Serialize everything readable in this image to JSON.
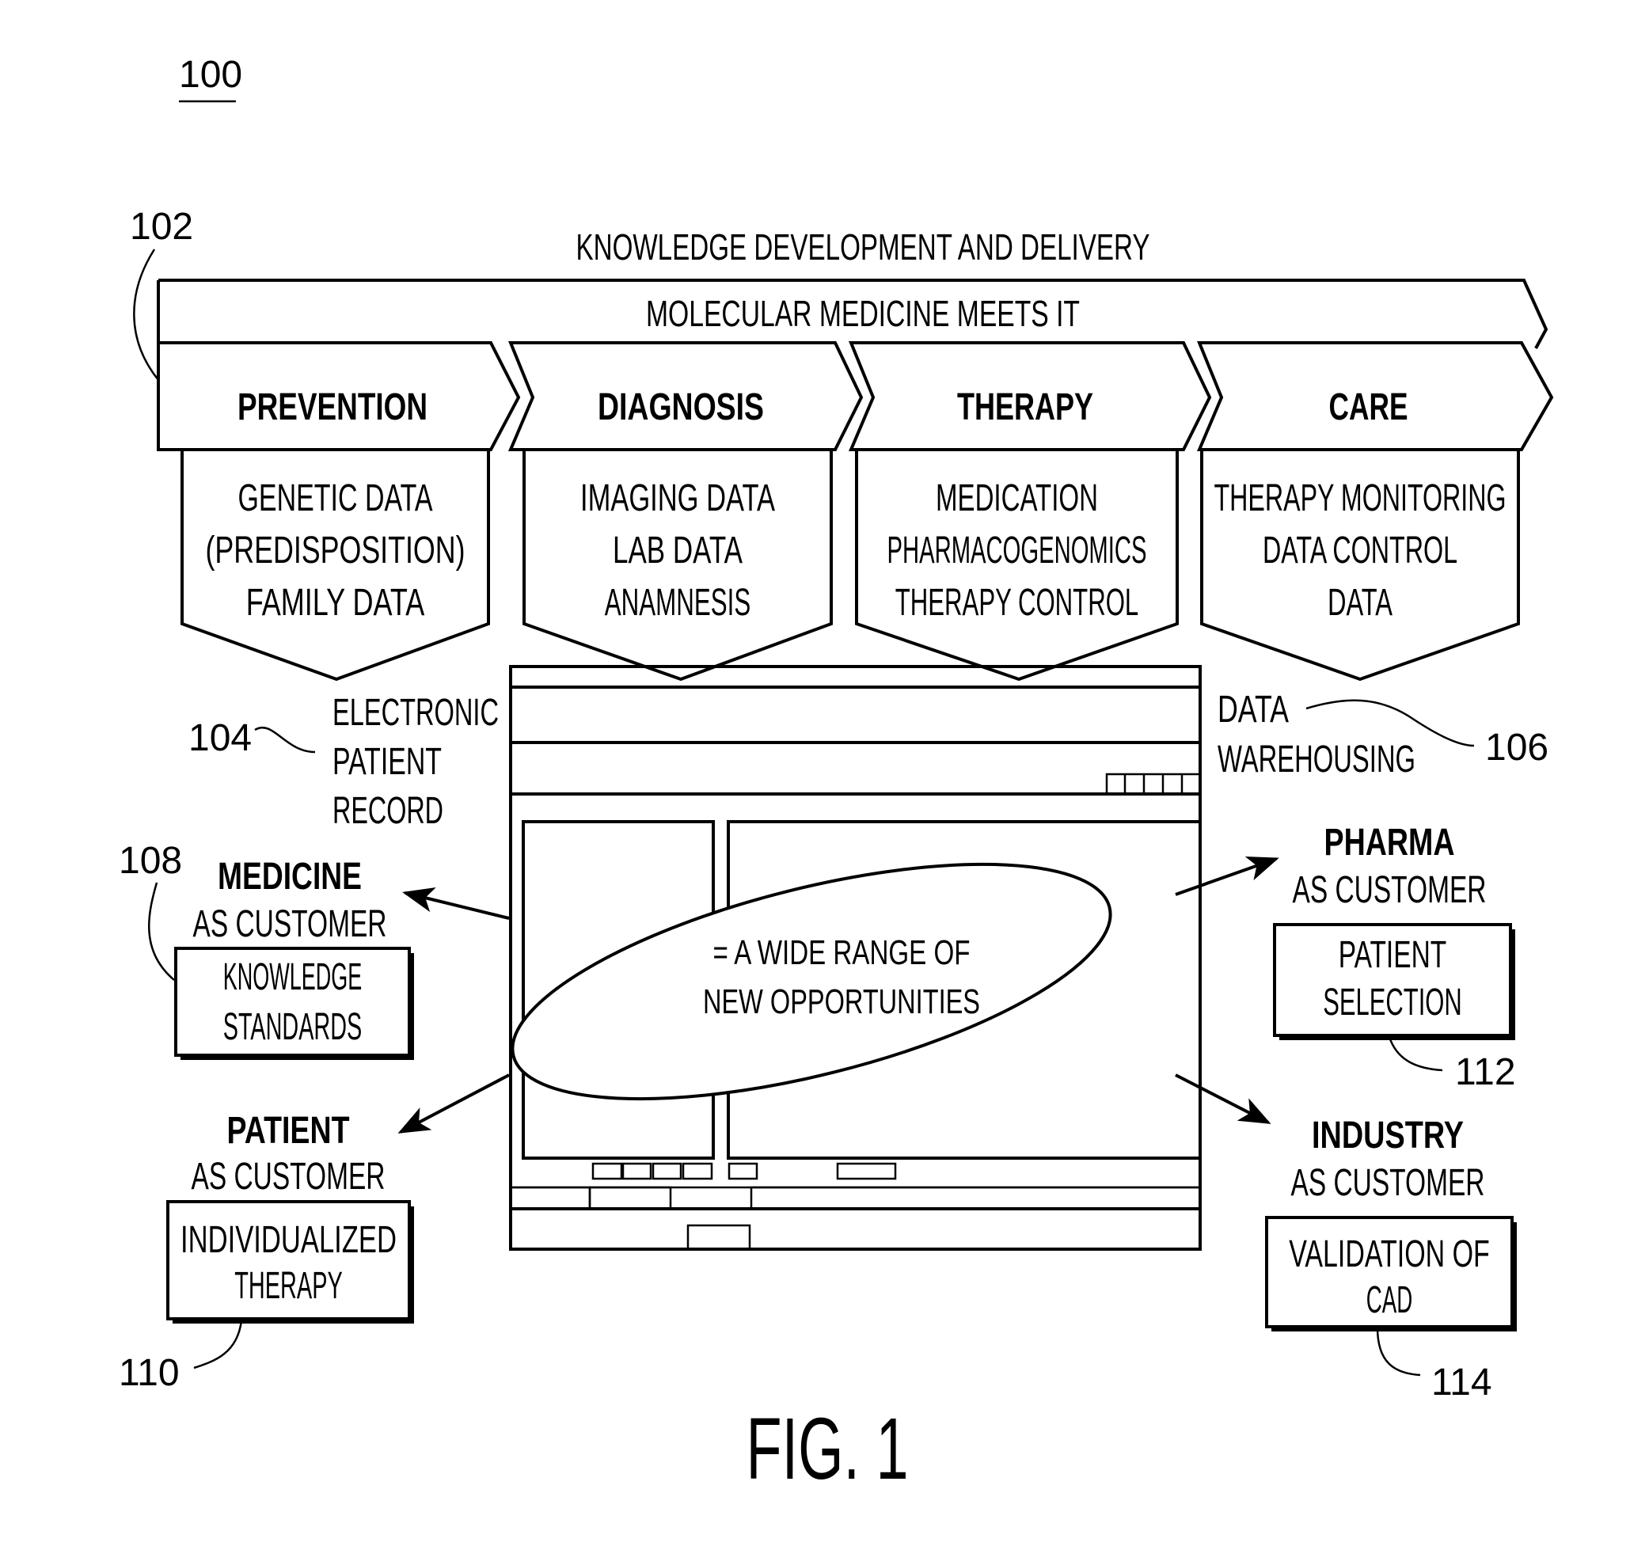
{
  "figure": {
    "number_ref": "100",
    "caption": "FIG. 1"
  },
  "header": {
    "outer_title": "KNOWLEDGE DEVELOPMENT AND DELIVERY",
    "band_label": "MOLECULAR MEDICINE MEETS IT",
    "band_ref": "102"
  },
  "stages": [
    {
      "title": "PREVENTION",
      "lines": [
        "GENETIC DATA",
        "(PREDISPOSITION)",
        "FAMILY DATA"
      ]
    },
    {
      "title": "DIAGNOSIS",
      "lines": [
        "IMAGING DATA",
        "LAB DATA",
        "ANAMNESIS"
      ]
    },
    {
      "title": "THERAPY",
      "lines": [
        "MEDICATION",
        "PHARMACOGENOMICS",
        "THERAPY CONTROL"
      ]
    },
    {
      "title": "CARE",
      "lines": [
        "THERAPY MONITORING",
        "DATA CONTROL",
        "DATA"
      ]
    }
  ],
  "center": {
    "electronic_record": {
      "ref": "104",
      "lines": [
        "ELECTRONIC",
        "PATIENT",
        "RECORD"
      ]
    },
    "data_warehousing": {
      "ref": "106",
      "lines": [
        "DATA",
        "WAREHOUSING"
      ]
    },
    "ellipse_lines": [
      "= A WIDE RANGE OF",
      "NEW OPPORTUNITIES"
    ]
  },
  "customers": [
    {
      "id": "medicine",
      "title": "MEDICINE",
      "subtitle": "AS CUSTOMER",
      "box_lines": [
        "KNOWLEDGE",
        "STANDARDS"
      ],
      "ref": "108"
    },
    {
      "id": "patient",
      "title": "PATIENT",
      "subtitle": "AS CUSTOMER",
      "box_lines": [
        "INDIVIDUALIZED",
        "THERAPY"
      ],
      "ref": "110"
    },
    {
      "id": "pharma",
      "title": "PHARMA",
      "subtitle": "AS CUSTOMER",
      "box_lines": [
        "PATIENT",
        "SELECTION"
      ],
      "ref": "112"
    },
    {
      "id": "industry",
      "title": "INDUSTRY",
      "subtitle": "AS CUSTOMER",
      "box_lines": [
        "VALIDATION OF",
        "CAD"
      ],
      "ref": "114"
    }
  ],
  "colors": {
    "ink": "#000000",
    "paper": "#ffffff"
  }
}
